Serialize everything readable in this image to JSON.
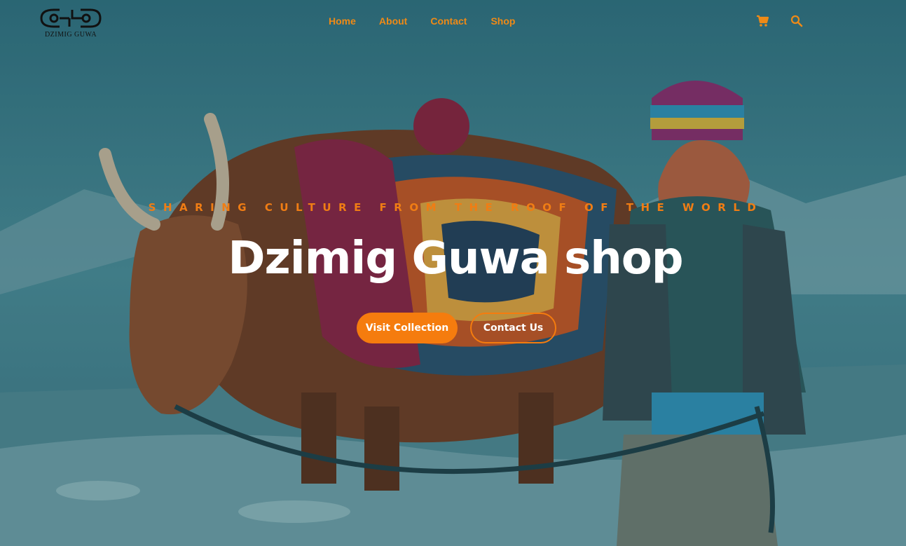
{
  "brand": {
    "logo_text": "DZIMIG GUWA"
  },
  "nav": {
    "items": [
      {
        "label": "Home"
      },
      {
        "label": "About"
      },
      {
        "label": "Contact"
      },
      {
        "label": "Shop"
      }
    ]
  },
  "header_icons": {
    "cart": "shopping-cart-icon",
    "search": "search-icon"
  },
  "hero": {
    "tagline": "SHARING CULTURE FROM THE ROOF OF THE WORLD",
    "title": "Dzimig Guwa shop",
    "primary_button": "Visit Collection",
    "secondary_button": "Contact Us"
  },
  "colors": {
    "accent": "#f57c0e",
    "background": "#3e7b86",
    "title": "#ffffff"
  }
}
